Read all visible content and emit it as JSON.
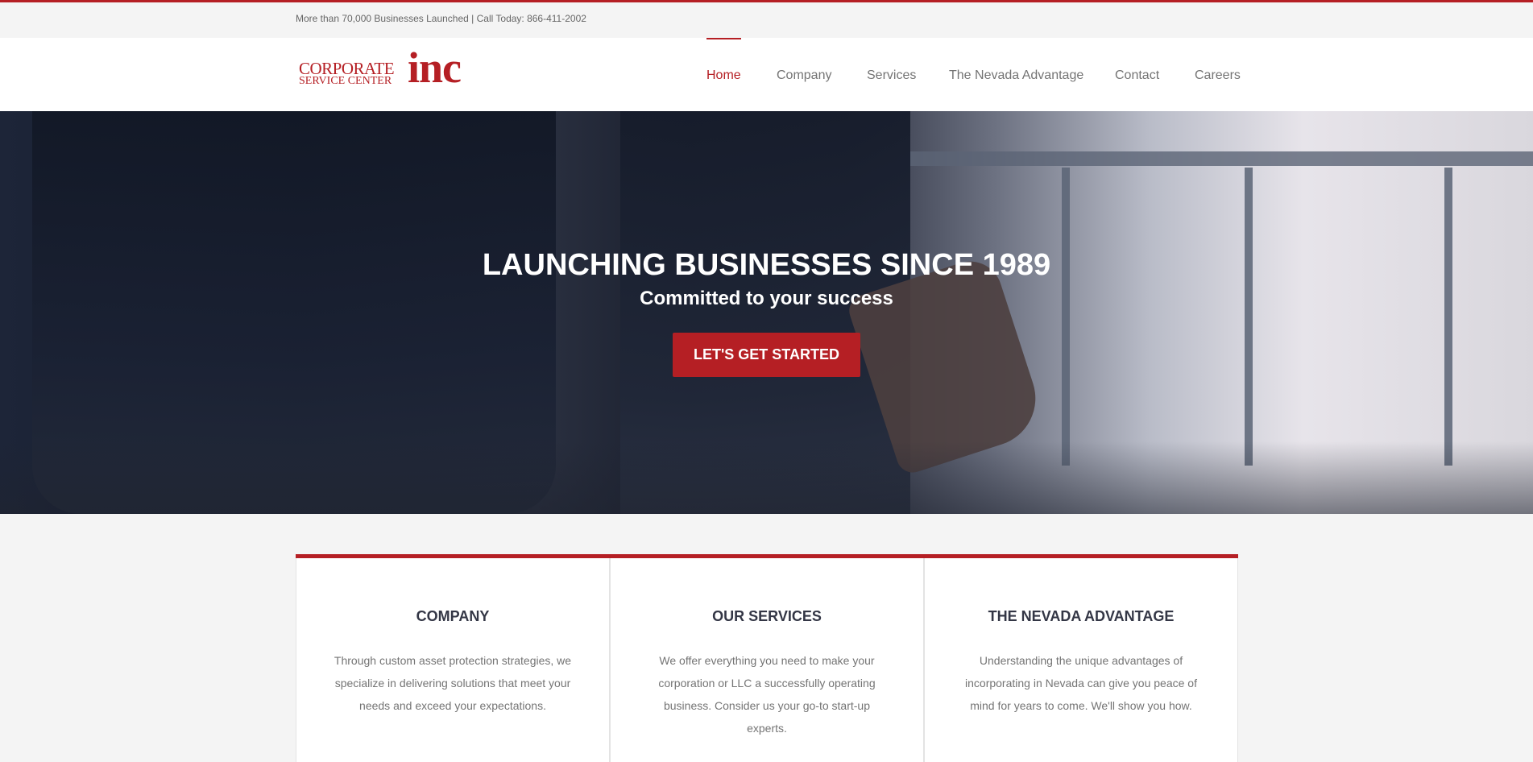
{
  "topbar": {
    "info": "More than 70,000 Businesses Launched | Call Today: 866-411-2002"
  },
  "logo": {
    "line1": "CORPORATE",
    "line2": "SERVICE CENTER",
    "inc": "inc"
  },
  "nav": {
    "items": [
      {
        "label": "Home",
        "active": true
      },
      {
        "label": "Company",
        "active": false
      },
      {
        "label": "Services",
        "active": false
      },
      {
        "label": "The Nevada Advantage",
        "active": false
      },
      {
        "label": "Contact",
        "active": false
      },
      {
        "label": "Careers",
        "active": false
      }
    ]
  },
  "hero": {
    "title": "LAUNCHING BUSINESSES SINCE 1989",
    "subtitle": "Committed to your success",
    "cta": "LET'S GET STARTED"
  },
  "cards": [
    {
      "title": "COMPANY",
      "text": "Through custom asset protection strategies, we specialize in delivering solutions that meet your needs and exceed your expectations."
    },
    {
      "title": "OUR SERVICES",
      "text": "We offer everything you need to make your corporation or LLC a successfully operating business. Consider us your go-to start-up experts."
    },
    {
      "title": "THE NEVADA ADVANTAGE",
      "text": "Understanding the unique advantages of incorporating in Nevada can give you peace of mind for years to come. We'll show you how."
    }
  ],
  "colors": {
    "brand": "#b51f24",
    "nav_text": "#747474",
    "heading": "#333645",
    "body_text": "#747474",
    "background": "#f4f4f4"
  }
}
